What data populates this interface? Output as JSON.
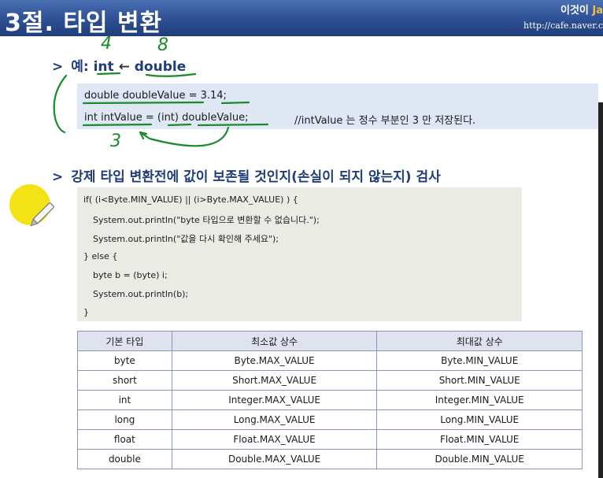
{
  "header": {
    "title": "3절. 타입 변환",
    "brand_main": "이것이 ",
    "brand_tail": "Ja",
    "url": "http://cafe.naver.c"
  },
  "bullet1": {
    "prefix": "예: ",
    "int": "int",
    "arrow": "←",
    "double": "double"
  },
  "handwriting": {
    "four": "4",
    "eight": "8",
    "three": "3"
  },
  "code1": {
    "line1": "double doubleValue = 3.14;",
    "line2_code": "int intValue = (int) doubleValue;",
    "line2_comment": "//intValue 는 정수 부분인 3 만 저장된다."
  },
  "bullet2": {
    "text": "강제 타입 변환전에 값이 보존될 것인지(손실이 되지 않는지) 검사"
  },
  "code2": [
    "if( (i<Byte.MIN_VALUE) || (i>Byte.MAX_VALUE) ) {",
    "System.out.println(\"byte 타입으로 변환할 수 없습니다.\");",
    "System.out.println(\"값을 다시 확인해 주세요\");",
    "} else {",
    "byte b = (byte) i;",
    "System.out.println(b);",
    "}"
  ],
  "table": {
    "headers": [
      "기본 타입",
      "최소값 상수",
      "최대값 상수"
    ],
    "rows": [
      [
        "byte",
        "Byte.MAX_VALUE",
        "Byte.MIN_VALUE"
      ],
      [
        "short",
        "Short.MAX_VALUE",
        "Short.MIN_VALUE"
      ],
      [
        "int",
        "Integer.MAX_VALUE",
        "Integer.MIN_VALUE"
      ],
      [
        "long",
        "Long.MAX_VALUE",
        "Long.MIN_VALUE"
      ],
      [
        "float",
        "Float.MAX_VALUE",
        "Float.MIN_VALUE"
      ],
      [
        "double",
        "Double.MAX_VALUE",
        "Double.MIN_VALUE"
      ]
    ]
  },
  "colors": {
    "header_bg": "#2d4f93",
    "bullet_text": "#1f3d7a",
    "annotation_green": "#1a8a2a",
    "code1_bg": "#dfe6f4",
    "code2_bg": "#ebebe6",
    "cursor_yellow": "#f2e20a"
  }
}
